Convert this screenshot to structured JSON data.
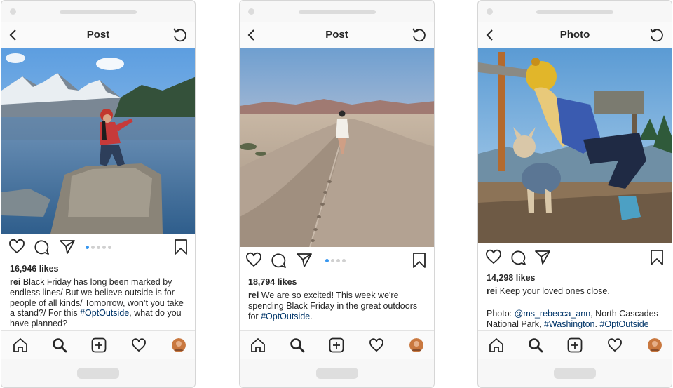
{
  "posts": [
    {
      "title": "Post",
      "likes": "16,946 likes",
      "username": "rei",
      "caption": "Black Friday has long been marked by endless lines/ But we believe outside is for people of all kinds/  Tomorrow, won’t you take a stand?/ For this ",
      "hashtag": "#OptOutside",
      "caption_end": ", what do you have planned?",
      "carousel_count": 5,
      "carousel_active": 1
    },
    {
      "title": "Post",
      "likes": "18,794 likes",
      "username": "rei",
      "caption": "We are so excited! This week we're spending Black Friday in the great outdoors for ",
      "hashtag": "#OptOutside",
      "caption_end": ".",
      "carousel_count": 4,
      "carousel_active": 1
    },
    {
      "title": "Photo",
      "likes": "14,298 likes",
      "username": "rei",
      "caption": "Keep your loved ones close.",
      "photo_credit_prefix": "Photo: ",
      "mention": "@ms_rebecca_ann",
      "credit_mid": ", North Cascades National Park, ",
      "hashtag_1": "#Washington",
      "credit_sep": ". ",
      "hashtag_2": "#OptOutside"
    }
  ],
  "colors": {
    "link": "#003569",
    "carousel_active": "#3897f0",
    "text": "#262626"
  },
  "icons": [
    "back-arrow-icon",
    "refresh-icon",
    "heart-icon",
    "comment-icon",
    "share-icon",
    "bookmark-icon",
    "home-icon",
    "search-icon",
    "add-icon",
    "activity-heart-icon",
    "profile-avatar"
  ]
}
